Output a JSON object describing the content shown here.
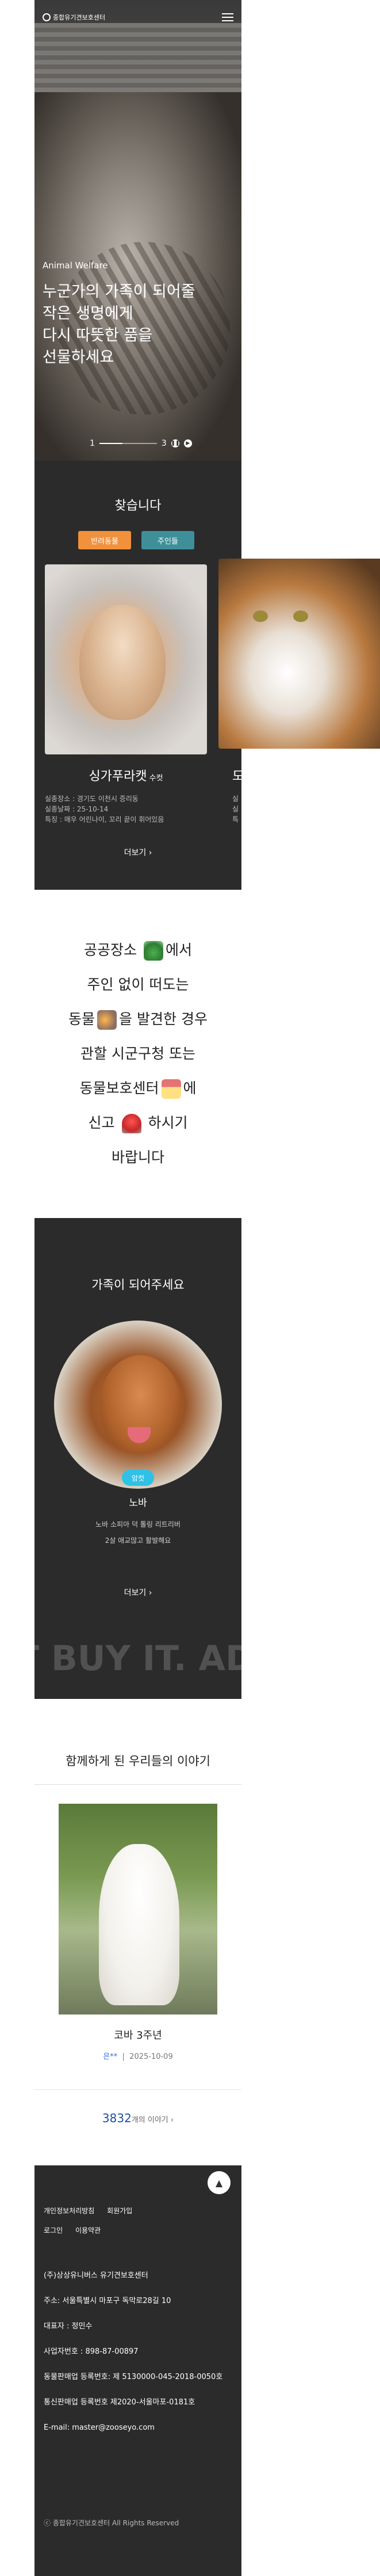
{
  "header": {
    "logo_text": "종합유기견보호센터",
    "menu_icon": "hamburger-icon"
  },
  "hero": {
    "tag": "Animal Welfare",
    "title": "누군가의 가족이 되어줄\n작은 생명에게\n다시 따뜻한 품을\n선물하세요",
    "pager_current": "1",
    "pager_total": "3"
  },
  "find": {
    "title": "찾습니다",
    "tabs": [
      "반려동물",
      "주인들"
    ],
    "cards": [
      {
        "name": "싱가푸라캣",
        "gender": "수컷",
        "info": [
          "실종장소 : 경기도 이천시 증리동",
          "실종날짜 : 25-10-14",
          "특징 : 매우 어린나이, 꼬리 끝이 휘어있음"
        ]
      },
      {
        "name": "도",
        "info": [
          "실",
          "실",
          "특"
        ]
      }
    ],
    "more": "더보기  ›"
  },
  "notice": {
    "line1a": "공공장소",
    "line1b": "에서",
    "line2": "주인 없이 떠도는",
    "line3a": "동물",
    "line3b": "을 발견한 경우",
    "line4": "관할 시군구청 또는",
    "line5a": "동물보호센터",
    "line5b": "에",
    "line6a": "신고",
    "line6b": "하시기",
    "line7": "바랍니다"
  },
  "adopt": {
    "title": "가족이 되어주세요",
    "badge": "암컷",
    "name": "노바",
    "desc": [
      "노바 소피아 덕 톨링 리트리버",
      "2살 애교많고 활발해요"
    ],
    "more": "더보기  ›",
    "watermark": "T BUY IT. ADO"
  },
  "stories": {
    "title": "함께하게 된 우리들의 이야기",
    "item_title": "코바 3주년",
    "author": "은**",
    "date": "2025-10-09",
    "count": "3832",
    "count_label": "개의 이야기  ›"
  },
  "footer": {
    "links": [
      "개인정보처리방침",
      "회원가입",
      "로그인",
      "이용약관"
    ],
    "company": "(주)상상유니버스 유기견보호센터",
    "address": "주소: 서울특별시 마포구 독막로28길 10",
    "ceo": "대표자 : 정민수",
    "biz_no": "사업자번호 : 898-87-00897",
    "animal_reg": "동물판매업 등록번호: 제 5130000-045-2018-0050호",
    "ecommerce": "통신판매업 등록번호 제2020-서울마포-0181호",
    "email": "E-mail: master@zooseyo.com",
    "copyright": "ⓒ 종합유기견보호센터 All Rights Reserved"
  }
}
